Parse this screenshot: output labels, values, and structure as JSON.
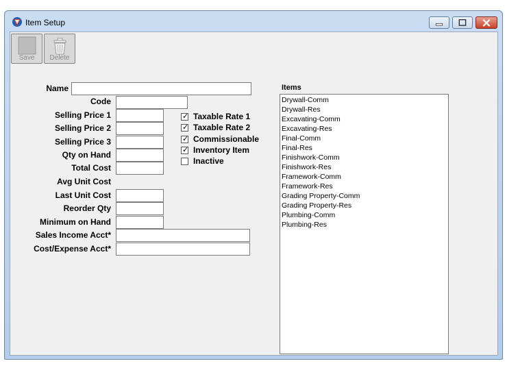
{
  "window": {
    "title": "Item Setup"
  },
  "toolbar": {
    "save_label": "Save",
    "delete_label": "Delete"
  },
  "form": {
    "name_label": "Name",
    "code_label": "Code",
    "selling_price_1_label": "Selling Price 1",
    "selling_price_2_label": "Selling Price 2",
    "selling_price_3_label": "Selling Price 3",
    "qty_on_hand_label": "Qty on Hand",
    "total_cost_label": "Total Cost",
    "avg_unit_cost_label": "Avg Unit Cost",
    "last_unit_cost_label": "Last Unit Cost",
    "reorder_qty_label": "Reorder Qty",
    "minimum_on_hand_label": "Minimum on Hand",
    "sales_income_acct_label": "Sales Income Acct*",
    "cost_expense_acct_label": "Cost/Expense Acct*",
    "name_value": "",
    "code_value": "",
    "selling_price_1_value": "",
    "selling_price_2_value": "",
    "selling_price_3_value": "",
    "qty_on_hand_value": "",
    "total_cost_value": "",
    "last_unit_cost_value": "",
    "reorder_qty_value": "",
    "minimum_on_hand_value": "",
    "sales_income_acct_value": "",
    "cost_expense_acct_value": ""
  },
  "checkboxes": [
    {
      "label": "Taxable Rate 1",
      "checked": true
    },
    {
      "label": "Taxable Rate 2",
      "checked": true
    },
    {
      "label": "Commissionable",
      "checked": true
    },
    {
      "label": "Inventory Item",
      "checked": true
    },
    {
      "label": "Inactive",
      "checked": false
    }
  ],
  "check_mark": "✓",
  "items": {
    "title": "Items",
    "list": [
      "Drywall-Comm",
      "Drywall-Res",
      "Excavating-Comm",
      "Excavating-Res",
      "Final-Comm",
      "Final-Res",
      "Finishwork-Comm",
      "Finishwork-Res",
      "Framework-Comm",
      "Framework-Res",
      "Grading Property-Comm",
      "Grading Property-Res",
      "Plumbing-Comm",
      "Plumbing-Res"
    ]
  },
  "icons": {
    "app": "app-logo-icon",
    "save": "save-icon",
    "delete": "trash-icon",
    "minimize": "minimize-icon",
    "maximize": "maximize-icon",
    "close": "close-icon"
  },
  "colors": {
    "titlebar": "#c9dcf2",
    "client_bg": "#f0f0f0",
    "close_button": "#c6422a"
  }
}
